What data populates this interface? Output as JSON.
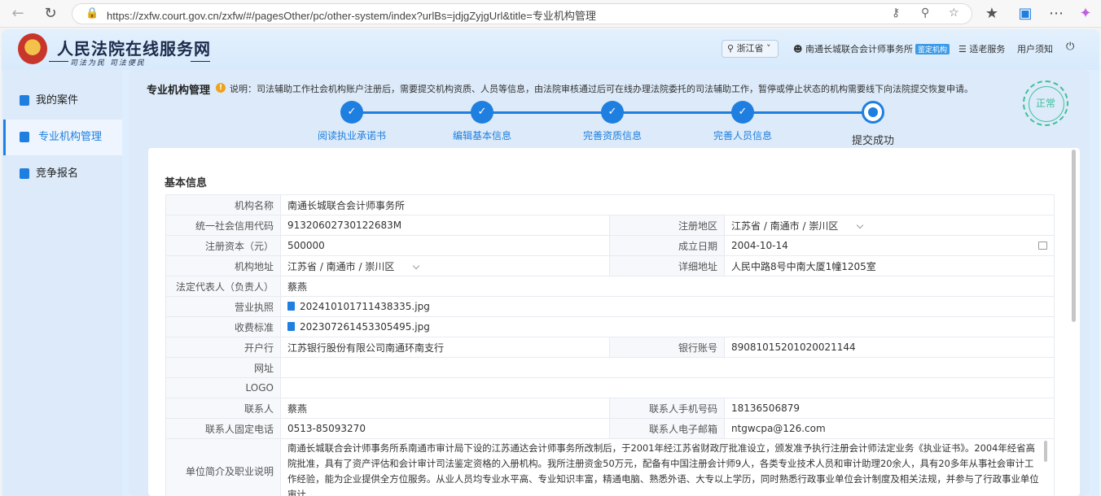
{
  "browser": {
    "url": "https://zxfw.court.gov.cn/zxfw/#/pagesOther/pc/other-system/index?urlBs=jdjgZyjgUrl&title=专业机构管理"
  },
  "header": {
    "site_name": "人民法院在线服务网",
    "slogan": "司法为民  司法便民",
    "region": "浙江省",
    "user_name": "南通长城联合会计师事务所",
    "user_badge": "鉴定机构",
    "elder_service": "适老服务",
    "user_notice": "用户须知"
  },
  "sidebar": {
    "items": [
      {
        "label": "我的案件"
      },
      {
        "label": "专业机构管理"
      },
      {
        "label": "竞争报名"
      }
    ]
  },
  "main": {
    "title": "专业机构管理",
    "note": "说明：司法辅助工作社会机构账户注册后，需要提交机构资质、人员等信息，由法院审核通过后可在线办理法院委托的司法辅助工作，暂停或停止状态的机构需要线下向法院提交恢复申请。",
    "status_stamp": "正常",
    "steps": [
      {
        "label": "阅读执业承诺书",
        "state": "done"
      },
      {
        "label": "编辑基本信息",
        "state": "done"
      },
      {
        "label": "完善资质信息",
        "state": "done"
      },
      {
        "label": "完善人员信息",
        "state": "done"
      },
      {
        "label": "提交成功",
        "state": "current"
      }
    ],
    "section_title": "基本信息"
  },
  "form": {
    "org_name_label": "机构名称",
    "org_name": "南通长城联合会计师事务所",
    "credit_code_label": "统一社会信用代码",
    "credit_code": "91320602730122683M",
    "reg_area_label": "注册地区",
    "reg_area": "江苏省 / 南通市 / 崇川区",
    "capital_label": "注册资本（元）",
    "capital": "500000",
    "found_date_label": "成立日期",
    "found_date": "2004-10-14",
    "address_label": "机构地址",
    "address": "江苏省 / 南通市 / 崇川区",
    "detail_address_label": "详细地址",
    "detail_address": "人民中路8号中南大厦1幢1205室",
    "legal_rep_label": "法定代表人（负责人）",
    "legal_rep": "蔡燕",
    "license_label": "营业执照",
    "license_file": "202410101711438335.jpg",
    "fee_label": "收费标准",
    "fee_file": "202307261453305495.jpg",
    "bank_label": "开户行",
    "bank": "江苏银行股份有限公司南通环南支行",
    "account_label": "银行账号",
    "account": "89081015201020021144",
    "website_label": "网址",
    "website": "",
    "logo_label": "LOGO",
    "contact_label": "联系人",
    "contact": "蔡燕",
    "mobile_label": "联系人手机号码",
    "mobile": "18136506879",
    "phone_label": "联系人固定电话",
    "phone": "0513-85093270",
    "email_label": "联系人电子邮箱",
    "email": "ntgwcpa@126.com",
    "intro_label": "单位简介及职业说明",
    "intro": "南通长城联合会计师事务所系南通市审计局下设的江苏通达会计师事务所改制后，于2001年经江苏省财政厅批准设立，颁发准予执行注册会计师法定业务《执业证书》。2004年经省高院批准，具有了资产评估和会计审计司法鉴定资格的入册机构。我所注册资金50万元，配备有中国注册会计师9人，各类专业技术人员和审计助理20余人，具有20多年从事社会审计工作经验，能为企业提供全方位服务。从业人员均专业水平高、专业知识丰富，精通电脑、熟悉外语、大专以上学历，同时熟悉行政事业单位会计制度及相关法规，并参与了行政事业单位审计"
  },
  "colors": {
    "accent": "#1e7fe0",
    "stamp": "#3fbf99"
  }
}
